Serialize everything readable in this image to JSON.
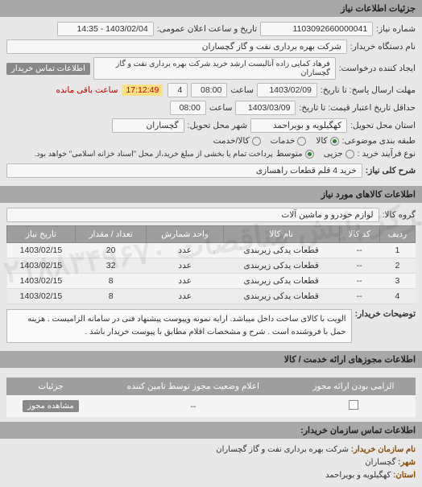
{
  "sections": {
    "details_title": "جزئیات اطلاعات نیاز",
    "items_title": "اطلاعات کالاهای مورد نیاز",
    "permits_title": "اطلاعات مجوزهای ارائه خدمت / کالا",
    "footer_title": "اطلاعات تماس سازمان خریدار:"
  },
  "labels": {
    "req_no": "شماره نیاز:",
    "public_date": "تاریخ و ساعت اعلان عمومی:",
    "buyer_name": "نام دستگاه خریدار:",
    "requester": "ایجاد کننده درخواست:",
    "buyer_contact_btn": "اطلاعات تماس خریدار",
    "resp_deadline": "مهلت ارسال پاسخ: تا تاریخ:",
    "time_lbl": "ساعت",
    "remaining_to_deadline": "ساعت باقی مانده",
    "at_least": "حداقل تاریخ اعتبار قیمت: تا تاریخ:",
    "province": "استان محل تحویل:",
    "city": "شهر محل تحویل:",
    "packing": "طبقه بندی موضوعی:",
    "kala_o": "کالا",
    "khadamat_o": "خدمات",
    "kala_khadamat_o": "کالا/خدمت",
    "buy_process": "نوع فرآیند خرید :",
    "jozi_o": "جزیی",
    "motevasset_o": "متوسط",
    "buy_process_note": "پرداخت تمام یا بخشی از مبلغ خرید،از محل \"اسناد خزانه اسلامی\" خواهد بود.",
    "need_desc": "شرح کلی نیاز:",
    "group": "گروه کالا:",
    "buyer_notes": "توضیحات خریدار:",
    "view_permit_btn": "مشاهده مجوز",
    "org_name_lbl": "نام سازمان خریدار:",
    "city_lbl": "شهر:",
    "province_lbl": "استان:"
  },
  "values": {
    "req_no": "1103092660000041",
    "public_date": "1403/02/04 - 14:35",
    "buyer_name": "شرکت بهره برداری نفت و گاز گچساران",
    "requester": "فرهاد کمایی زاده آنالیست ارشد خرید شرکت بهره برداری نفت و گاز گچساران",
    "resp_date": "1403/02/09",
    "resp_time": "08:00",
    "remain_days": "4",
    "remain_clock": "17:12:49",
    "valid_date": "1403/03/09",
    "valid_time": "08:00",
    "province": "کهگیلویه و بویراحمد",
    "city": "گچساران",
    "need_desc": "خرید 4 قلم قطعات راهسازی",
    "group": "لوازم خودرو و ماشین آلات",
    "buyer_notes": "الویت با کالای ساخت داخل میباشد. ارایه نمونه وپیوست پیشنهاد فنی در سامانه الزامیست . هزینه حمل با فروشنده است . شرح و مشخصات اقلام مطابق با پیوست خریدار باشد .",
    "perm_status": "--"
  },
  "items_table": {
    "headers": [
      "ردیف",
      "کد کالا",
      "نام کالا",
      "واحد شمارش",
      "تعداد / مقدار",
      "تاریخ نیاز"
    ],
    "rows": [
      [
        "1",
        "--",
        "قطعات یدکی زیربندی",
        "عدد",
        "20",
        "1403/02/15"
      ],
      [
        "2",
        "--",
        "قطعات یدکی زیربندی",
        "عدد",
        "32",
        "1403/02/15"
      ],
      [
        "3",
        "--",
        "قطعات یدکی زیربندی",
        "عدد",
        "8",
        "1403/02/15"
      ],
      [
        "4",
        "--",
        "قطعات یدکی زیربندی",
        "عدد",
        "8",
        "1403/02/15"
      ]
    ]
  },
  "perm_table": {
    "headers": [
      "الزامی بودن ارائه مجوز",
      "اعلام وضعیت مجوز توسط تامین کننده",
      "جزئیات"
    ]
  },
  "footer": {
    "org_name": "شرکت بهره برداری نفت و گاز گچساران",
    "city": "گچساران",
    "province": "کهگیلویه و بویراحمد"
  },
  "watermark": "مرکز پایش مناقصات ۰۲۱۸۸۳۴۹۶۷۰"
}
